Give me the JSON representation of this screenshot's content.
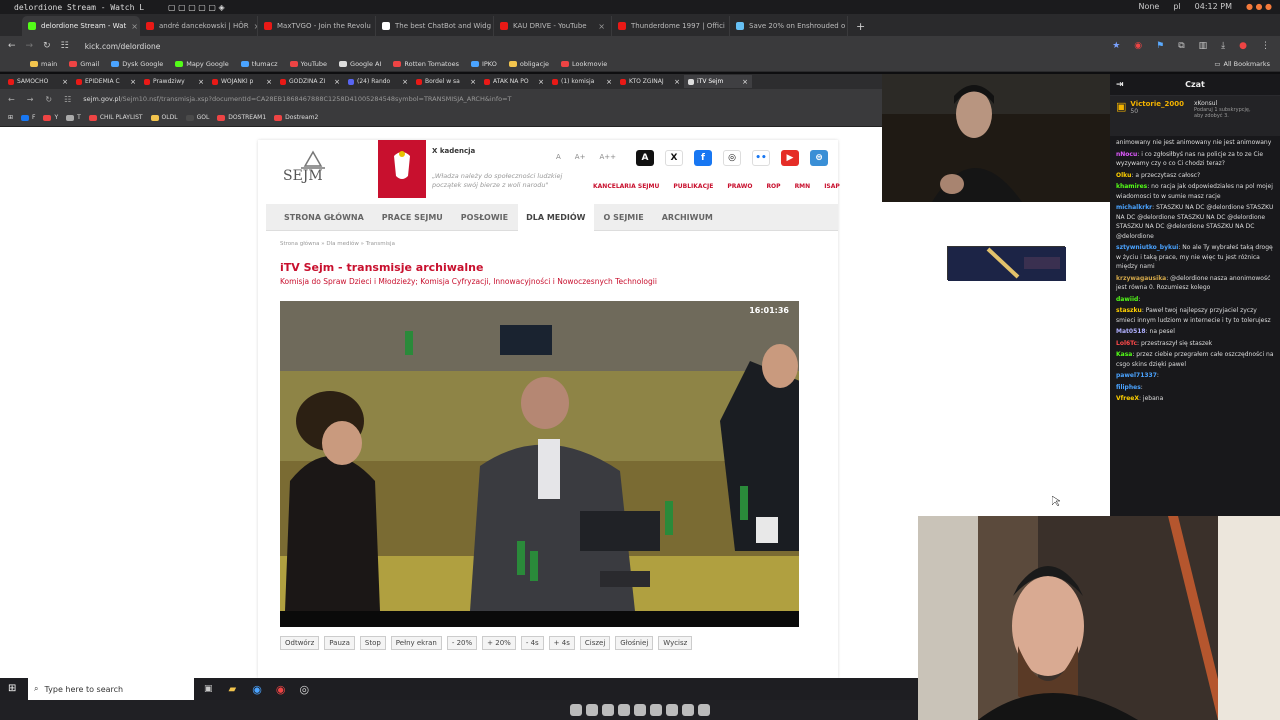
{
  "os": {
    "window_title": "delordione Stream - Watch L...",
    "right": [
      "None",
      "pl",
      "04:12 PM"
    ]
  },
  "outer_tabs": [
    {
      "label": "delordione Stream - Wat",
      "color": "#53fc18",
      "active": true
    },
    {
      "label": "andré dancekowski | HÖR",
      "color": "#e91916"
    },
    {
      "label": "MaxTVGO - Join the Revolu",
      "color": "#e91916"
    },
    {
      "label": "The best ChatBot and Widg",
      "color": "#ffffff"
    },
    {
      "label": "KAU DRIVE - YouTube",
      "color": "#e91916"
    },
    {
      "label": "Thunderdome 1997 | Offici",
      "color": "#e91916"
    },
    {
      "label": "Save 20% on Enshrouded o",
      "color": "#66c0f4"
    }
  ],
  "outer_url": "kick.com/delordione",
  "outer_bookmarks": [
    "main",
    "Gmail",
    "Dysk Google",
    "Mapy Google",
    "tłumacz",
    "YouTube",
    "Google AI",
    "Rotten Tomatoes",
    "IPKO",
    "obligacje",
    "Lookmovie"
  ],
  "all_bookmarks": "All Bookmarks",
  "inner_tabs": [
    {
      "label": "SAMOCHO",
      "color": "#e91916"
    },
    {
      "label": "EPIDEMIA C",
      "color": "#e91916"
    },
    {
      "label": "Prawdziwy",
      "color": "#e91916"
    },
    {
      "label": "WOJANKI p",
      "color": "#e91916"
    },
    {
      "label": "GODZINA ZI",
      "color": "#e91916"
    },
    {
      "label": "(24) Rando",
      "color": "#5865f2"
    },
    {
      "label": "Bordel w sa",
      "color": "#e91916"
    },
    {
      "label": "ATAK NA PO",
      "color": "#e91916"
    },
    {
      "label": "(1) komisja",
      "color": "#e91916"
    },
    {
      "label": "KTO ZGINAJ",
      "color": "#e91916"
    },
    {
      "label": "iTV Sejm",
      "color": "#dddddd",
      "active": true
    }
  ],
  "inner_url_domain": "sejm.gov.pl",
  "inner_url_path": "/Sejm10.nsf/transmisja.xsp?documentId=CA28EB1868467888C1258D41005284548symbol=TRANSMISJA_ARCH&info=T",
  "inner_bookmarks": [
    "F",
    "Y",
    "T",
    "CHIL PLAYLIST",
    "OLDL",
    "GOL",
    "DOSTREAM1",
    "Dostream2"
  ],
  "page": {
    "logo": "SEJM",
    "kadencja": "X kadencja",
    "motto": "„Władza należy do społeczności ludzkiej początek swój bierze z woli narodu\"",
    "font_sizes": [
      "A",
      "A+",
      "A++"
    ],
    "social": [
      "A",
      "X",
      "f",
      "◎",
      "••",
      "▶",
      "⊜"
    ],
    "top_links": [
      "KANCELARIA SEJMU",
      "PUBLIKACJE",
      "PRAWO",
      "ROP",
      "RMN",
      "ISAP"
    ],
    "nav": [
      "STRONA GŁÓWNA",
      "PRACE SEJMU",
      "POSŁOWIE",
      "DLA MEDIÓW",
      "O SEJMIE",
      "ARCHIWUM"
    ],
    "crumbs": "Strona główna  »  Dla mediów  »  Transmisja",
    "title": "iTV Sejm - transmisje archiwalne",
    "subtitle": "Komisja do Spraw Dzieci i Młodzieży; Komisja Cyfryzacji, Innowacyjności i Nowoczesnych Technologii",
    "video_time": "16:01:36",
    "controls": [
      "Odtwórz",
      "Pauza",
      "Stop",
      "Pełny ekran",
      "- 20%",
      "+ 20%",
      "- 4s",
      "+ 4s",
      "Ciszej",
      "Głośniej",
      "Wycisz"
    ]
  },
  "taskbar": {
    "search_placeholder": "Type here to search"
  },
  "chat": {
    "header": "Czat",
    "pinned": {
      "user": "Victorie_2000",
      "count": "50",
      "other": "xKonsul",
      "note": "Podaruj 1 subskrypcję, aby zdobyć 3."
    },
    "messages": [
      {
        "user": "",
        "color": "#ddd",
        "text": "animowany  nie jest animowany  nie jest animowany"
      },
      {
        "user": "nNocu",
        "color": "#e05aff",
        "text": "i co zgłosiłbyś nas na policje za to ze Cie wyzywamy czy o co Ci chodzi teraz?"
      },
      {
        "user": "Olku",
        "color": "#ffd000",
        "text": "a przeczytasz całosc?"
      },
      {
        "user": "khamires",
        "color": "#53fc18",
        "text": "no racja jak odpowiedziales na pol mojej wiadomosci to w sumie masz racje"
      },
      {
        "user": "michalkrkr",
        "color": "#4aa3ff",
        "text": "STASZKU NA DC @delordione STASZKU NA DC @delordione STASZKU NA DC @delordione STASZKU NA DC @delordione STASZKU NA DC @delordione"
      },
      {
        "user": "sztywniutko_bykui",
        "color": "#4aa3ff",
        "text": "No ale Ty wybrałeś taką drogę w życiu i taką prace, my nie więc tu jest różnica między nami"
      },
      {
        "user": "krzywagausika",
        "color": "#d4a84a",
        "text": "@delordione nasza anonimowość jest równa 0. Rozumiesz kolego"
      },
      {
        "user": "dawiid",
        "color": "#53fc18",
        "text": ""
      },
      {
        "user": "staszku",
        "color": "#ffd000",
        "text": "Paweł twoj najlepszy przyjaciel zyczy smieci innym ludziom w internecie i ty to tolerujesz"
      },
      {
        "user": "Mat0518",
        "color": "#b0b0ff",
        "text": "na pesel"
      },
      {
        "user": "Lol6Tc",
        "color": "#ff4a4a",
        "text": "przestraszył się staszek"
      },
      {
        "user": "Kasa",
        "color": "#53fc18",
        "text": "przez ciebie przegrałem całe oszczędności na csgo skins dzięki pawel"
      },
      {
        "user": "pawel71337",
        "color": "#4aa3ff",
        "text": ""
      },
      {
        "user": "filiphes",
        "color": "#4aa3ff",
        "text": ""
      },
      {
        "user": "VfreeX",
        "color": "#ffd000",
        "text": "jebana"
      }
    ]
  }
}
